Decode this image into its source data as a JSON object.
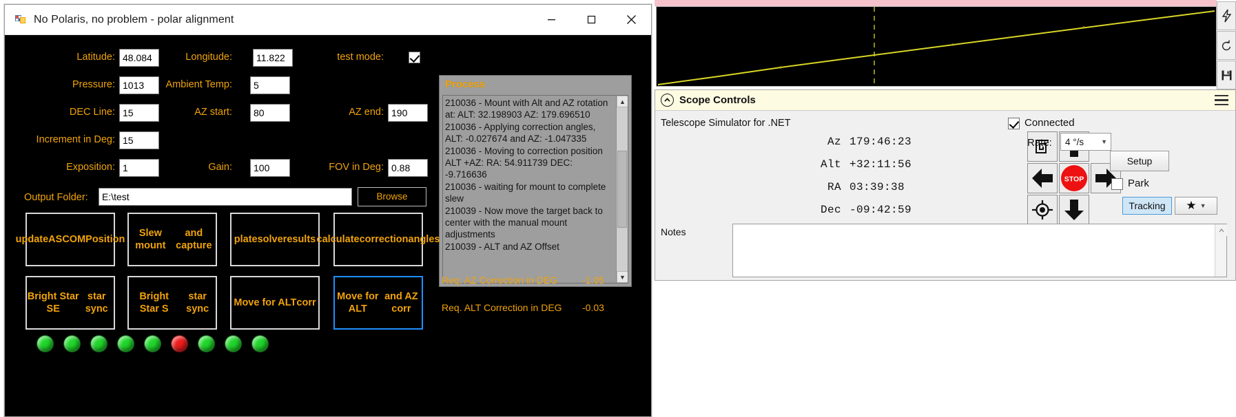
{
  "window": {
    "title": "No Polaris, no problem - polar alignment",
    "icon": "app-icon",
    "minimize": "—",
    "maximize": "☐",
    "close": "✕"
  },
  "form": {
    "fields": [
      {
        "label": "Latitude:",
        "value": "48.084",
        "name": "latitude"
      },
      {
        "label": "Longitude:",
        "value": "11.822",
        "name": "longitude"
      },
      {
        "label": "Pressure:",
        "value": "1013",
        "name": "pressure"
      },
      {
        "label": "Ambient Temp:",
        "value": "5",
        "name": "ambient-temp"
      },
      {
        "label": "DEC Line:",
        "value": "15",
        "name": "dec-line"
      },
      {
        "label": "AZ start:",
        "value": "80",
        "name": "az-start"
      },
      {
        "label": "AZ end:",
        "value": "190",
        "name": "az-end"
      },
      {
        "label": "Increment in Deg:",
        "value": "15",
        "name": "increment-in-deg"
      },
      {
        "label": "Exposition:",
        "value": "1",
        "name": "exposition"
      },
      {
        "label": "Gain:",
        "value": "100",
        "name": "gain"
      },
      {
        "label": "FOV in Deg:",
        "value": "0.88",
        "name": "fov-in-deg"
      }
    ],
    "test_mode_label": "test mode:",
    "test_mode_checked": true,
    "output_folder_label": "Output Folder:",
    "output_folder_value": "E:\\test",
    "browse_label": "Browse"
  },
  "process": {
    "title": "Process",
    "log": "210036 - Mount with Alt and AZ rotation at: ALT: 32.198903 AZ: 179.696510\n210036 - Applying correction angles, ALT: -0.027674 and AZ: -1.047335\n210036 - Moving to correction position ALT +AZ: RA: 54.911739 DEC: -9.716636\n210036 - waiting for mount to complete slew\n210039 - Now move the target back to center with the manual mount adjustments\n210039 - ALT and AZ Offset",
    "scroll_up": "▲",
    "scroll_down": "▼"
  },
  "buttons": {
    "row1": [
      {
        "label": "update\nASCOM\nPosition",
        "name": "update-ascom-position-button",
        "focused": false
      },
      {
        "label": "Slew mount\nand capture",
        "name": "slew-mount-and-capture-button",
        "focused": false
      },
      {
        "label": "platesolve\nresults",
        "name": "platesolve-results-button",
        "focused": false
      },
      {
        "label": "calculate\ncorrection\nangles",
        "name": "calculate-correction-angles-button",
        "focused": false
      }
    ],
    "row2": [
      {
        "label": "Bright Star SE\nstar sync",
        "name": "bright-star-se-star-sync-button",
        "focused": false
      },
      {
        "label": "Bright Star S\nstar sync",
        "name": "bright-star-s-star-sync-button",
        "focused": false
      },
      {
        "label": "Move for ALT\ncorr",
        "name": "move-for-alt-corr-button",
        "focused": false
      },
      {
        "label": "Move for ALT\nand AZ corr",
        "name": "move-for-alt-and-az-corr-button",
        "focused": true
      }
    ]
  },
  "corrections": [
    {
      "label": "Req. AZ Correction in DEG",
      "value": "-1.05"
    },
    {
      "label": "Req. ALT Correction in DEG",
      "value": "-0.03"
    }
  ],
  "leds": [
    {
      "color": "#1fd62a",
      "state": "on"
    },
    {
      "color": "#1fd62a",
      "state": "on"
    },
    {
      "color": "#1fd62a",
      "state": "on"
    },
    {
      "color": "#1fd62a",
      "state": "on"
    },
    {
      "color": "#1fd62a",
      "state": "on"
    },
    {
      "color": "#ee1c1c",
      "state": "error"
    },
    {
      "color": "#1fd62a",
      "state": "on"
    },
    {
      "color": "#1fd62a",
      "state": "on"
    },
    {
      "color": "#1fd62a",
      "state": "on"
    }
  ],
  "graph": {
    "line_color": "#d8d626",
    "marker_color": "#b3b126",
    "background": "#000000"
  },
  "graph_tools": [
    {
      "name": "lightning-icon",
      "glyph": "⚡"
    },
    {
      "name": "undo-icon",
      "glyph": "↺"
    },
    {
      "name": "save-icon",
      "glyph": "💾"
    }
  ],
  "scope": {
    "header_title": "Scope Controls",
    "driver_name": "Telescope Simulator for .NET",
    "connected_label": "Connected",
    "connected_checked": true,
    "coords": [
      {
        "label": "Az",
        "value": "179:46:23"
      },
      {
        "label": "Alt",
        "value": "+32:11:56"
      },
      {
        "label": "RA",
        "value": "03:39:38"
      },
      {
        "label": "Dec",
        "value": "-09:42:59"
      }
    ],
    "rate_label": "Rate:",
    "rate_value": "4 °/s",
    "setup_label": "Setup",
    "park_label": "Park",
    "park_checked": false,
    "tracking_label": "Tracking",
    "stop_label": "STOP",
    "notes_label": "Notes",
    "notes_value": "",
    "dpad": {
      "spiral": "spiral-icon",
      "up": "arrow-up-icon",
      "left": "arrow-left-icon",
      "stop": "stop-button",
      "right": "arrow-right-icon",
      "home": "home-target-icon",
      "down": "arrow-down-icon",
      "star": "★"
    }
  }
}
